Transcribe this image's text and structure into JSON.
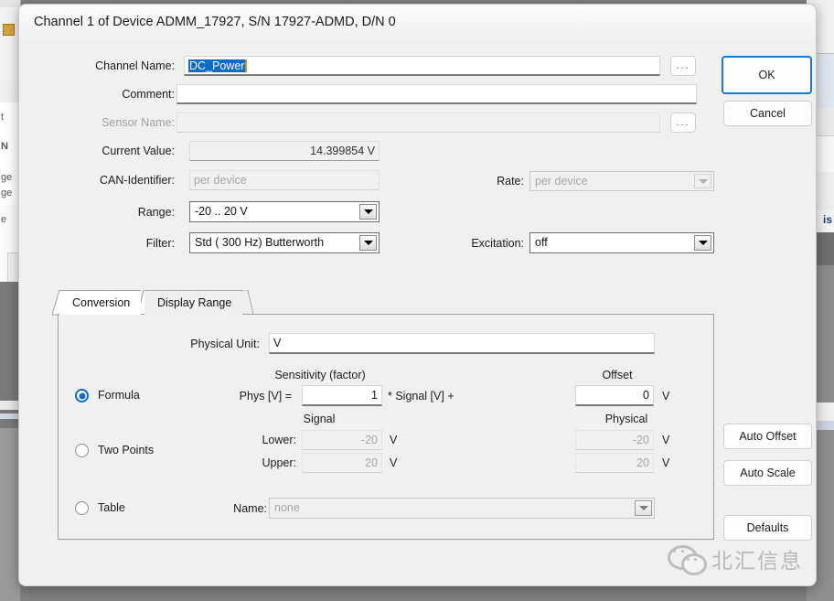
{
  "window": {
    "title": "Channel 1 of Device ADMM_17927, S/N 17927-ADMD, D/N 0"
  },
  "form": {
    "channel_name": {
      "label": "Channel Name:",
      "value": "DC_Power",
      "selected": true
    },
    "comment": {
      "label": "Comment:",
      "value": ""
    },
    "sensor_name": {
      "label": "Sensor Name:",
      "value": "",
      "disabled": true
    },
    "current_value": {
      "label": "Current Value:",
      "value": "14.399854 V"
    },
    "can_identifier": {
      "label": "CAN-Identifier:",
      "value": "per device",
      "disabled": true
    },
    "rate": {
      "label": "Rate:",
      "value": "per device",
      "disabled": true
    },
    "range": {
      "label": "Range:",
      "value": "-20 .. 20 V"
    },
    "filter": {
      "label": "Filter:",
      "value": "Std ( 300 Hz) Butterworth"
    },
    "excitation": {
      "label": "Excitation:",
      "value": "off"
    },
    "browse_label": "..."
  },
  "tabs": [
    {
      "label": "Conversion",
      "active": true
    },
    {
      "label": "Display Range",
      "active": false
    }
  ],
  "conversion": {
    "physical_unit": {
      "label": "Physical Unit:",
      "value": "V"
    },
    "modes": {
      "formula": {
        "label": "Formula",
        "selected": true
      },
      "two_points": {
        "label": "Two Points",
        "selected": false
      },
      "table": {
        "label": "Table",
        "selected": false
      }
    },
    "formula": {
      "sensitivity_header": "Sensitivity (factor)",
      "offset_header": "Offset",
      "phys_label": "Phys [V] =",
      "sensitivity_value": "1",
      "multiply_label": "* Signal [V] +",
      "offset_value": "0",
      "offset_unit": "V"
    },
    "two_points": {
      "signal_header": "Signal",
      "physical_header": "Physical",
      "lower_label": "Lower:",
      "upper_label": "Upper:",
      "signal_lower": "-20",
      "signal_upper": "20",
      "physical_lower": "-20",
      "physical_upper": "20",
      "unit": "V"
    },
    "table": {
      "name_label": "Name:",
      "name_value": "none"
    }
  },
  "buttons": {
    "ok": "OK",
    "cancel": "Cancel",
    "auto_offset": "Auto Offset",
    "auto_scale": "Auto Scale",
    "defaults": "Defaults"
  },
  "watermark": {
    "text": "北汇信息"
  },
  "background_hints": {
    "fragment_t": "t",
    "fragment_n": "N",
    "fragment_ge1": "ge",
    "fragment_ge2": "ge",
    "fragment_e": "e",
    "fragment_is": "is"
  },
  "colors": {
    "accent": "#0a6cc9",
    "focus_border": "#1578d2",
    "selection_bg": "#0a6cc9",
    "caret": "#e08a2e",
    "dialog_bg": "#f0f0f0"
  }
}
